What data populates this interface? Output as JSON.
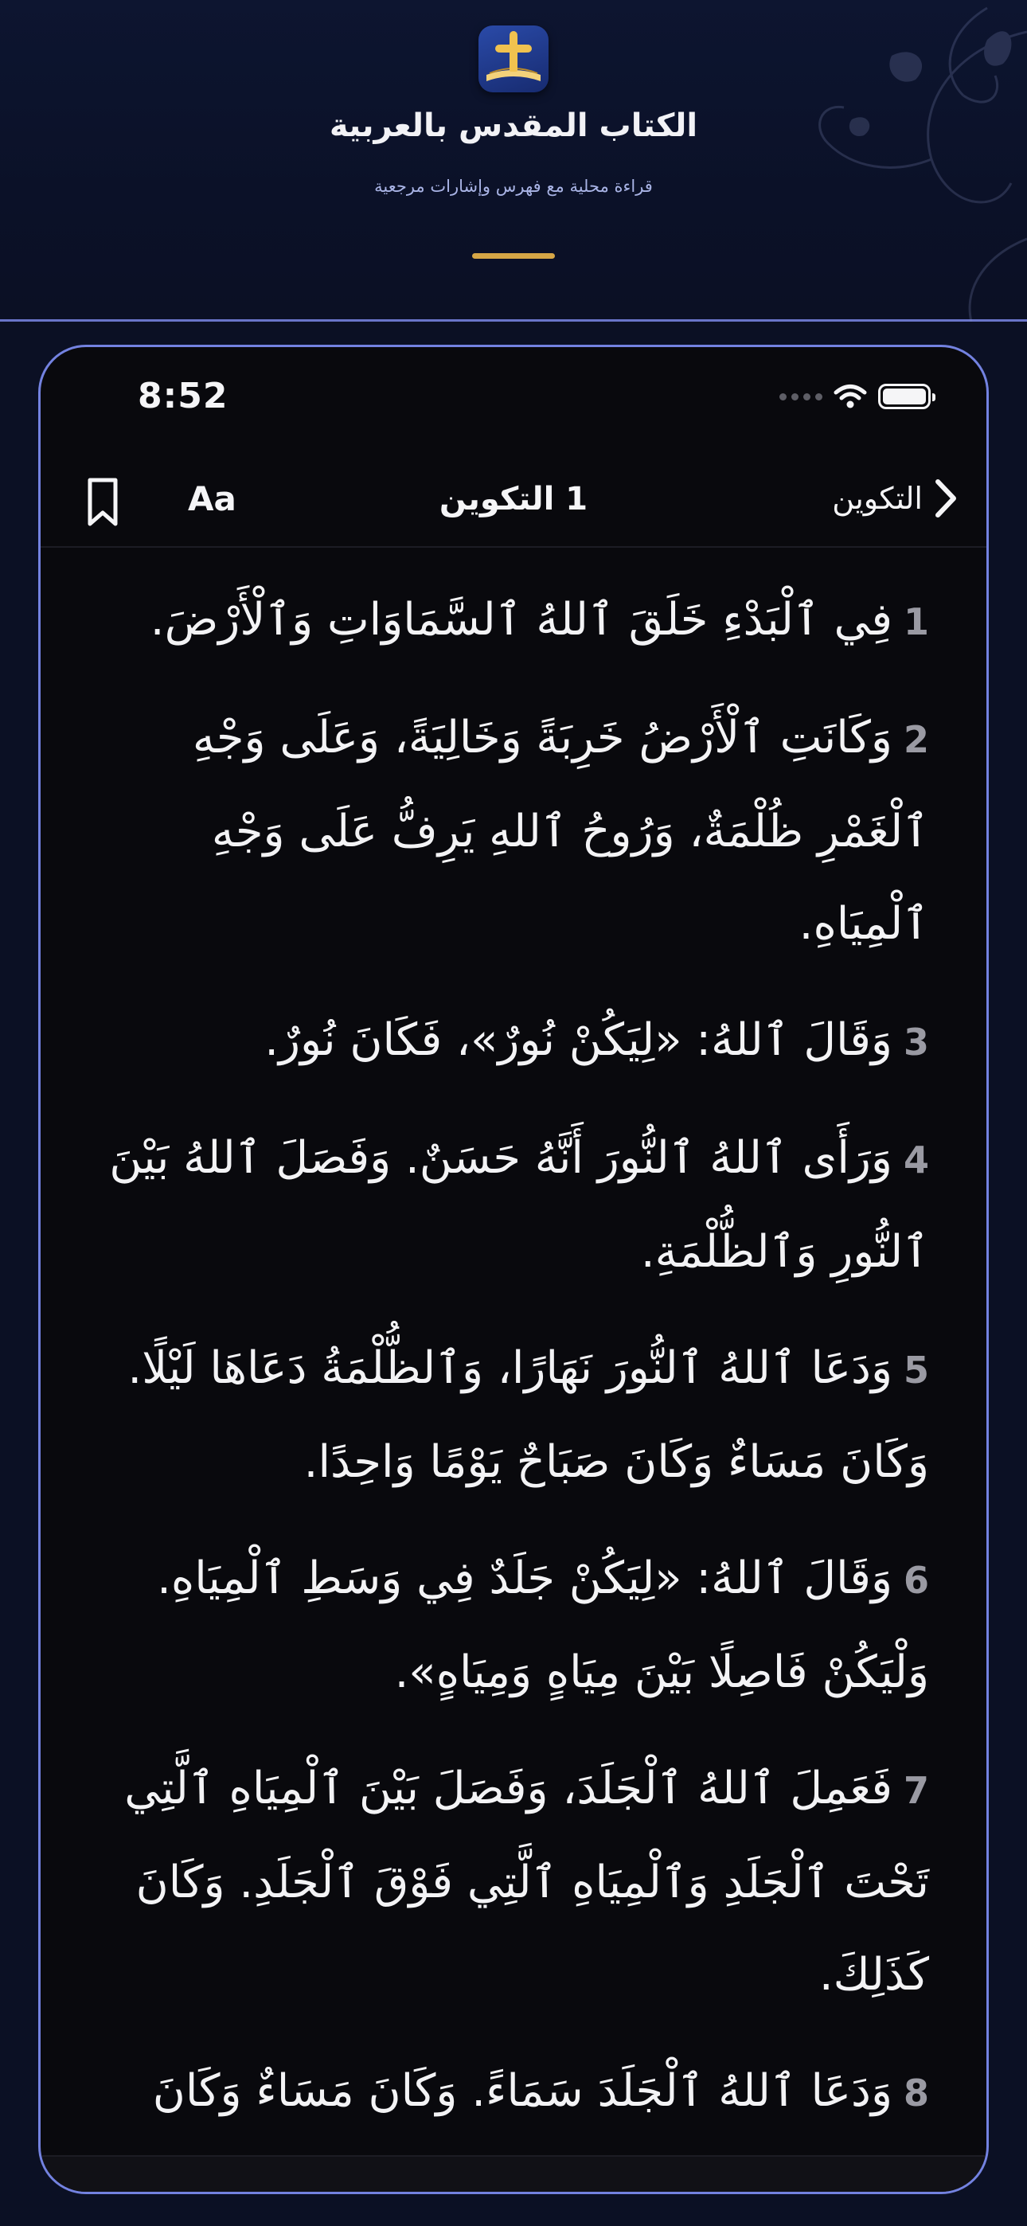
{
  "hero": {
    "title": "الكتاب المقدس بالعربية",
    "subtitle": "قراءة محلية مع فهرس وإشارات مرجعية",
    "app_icon": "bible-cross-icon",
    "accent_color": "#d6a646"
  },
  "status_bar": {
    "time": "8:52",
    "icons": [
      "signal-dots-icon",
      "wifi-icon",
      "battery-icon"
    ]
  },
  "navbar": {
    "back_label": "التكوين",
    "chapter_title": "1 التكوين",
    "font_button_label": "Aa",
    "bookmark_icon": "bookmark-icon"
  },
  "verses": [
    {
      "num": "1",
      "text": "فِي ٱلْبَدْءِ خَلَقَ ٱللهُ ٱلسَّمَاوَاتِ وَٱلْأَرْضَ."
    },
    {
      "num": "2",
      "text": "وَكَانَتِ ٱلْأَرْضُ خَرِبَةً وَخَالِيَةً، وَعَلَى وَجْهِ ٱلْغَمْرِ ظُلْمَةٌ، وَرُوحُ ٱللهِ يَرِفُّ عَلَى وَجْهِ ٱلْمِيَاهِ."
    },
    {
      "num": "3",
      "text": "وَقَالَ ٱللهُ: «لِيَكُنْ نُورٌ»، فَكَانَ نُورٌ."
    },
    {
      "num": "4",
      "text": "وَرَأَى ٱللهُ ٱلنُّورَ أَنَّهُ حَسَنٌ. وَفَصَلَ ٱللهُ بَيْنَ ٱلنُّورِ وَٱلظُّلْمَةِ."
    },
    {
      "num": "5",
      "text": "وَدَعَا ٱللهُ ٱلنُّورَ نَهَارًا، وَٱلظُّلْمَةُ دَعَاهَا لَيْلًا. وَكَانَ مَسَاءٌ وَكَانَ صَبَاحٌ يَوْمًا وَاحِدًا."
    },
    {
      "num": "6",
      "text": "وَقَالَ ٱللهُ: «لِيَكُنْ جَلَدٌ فِي وَسَطِ ٱلْمِيَاهِ. وَلْيَكُنْ فَاصِلًا بَيْنَ مِيَاهٍ وَمِيَاهٍ»."
    },
    {
      "num": "7",
      "text": "فَعَمِلَ ٱللهُ ٱلْجَلَدَ، وَفَصَلَ بَيْنَ ٱلْمِيَاهِ ٱلَّتِي تَحْتَ ٱلْجَلَدِ وَٱلْمِيَاهِ ٱلَّتِي فَوْقَ ٱلْجَلَدِ. وَكَانَ كَذَلِكَ."
    },
    {
      "num": "8",
      "text": "وَدَعَا ٱللهُ ٱلْجَلَدَ سَمَاءً. وَكَانَ مَسَاءٌ وَكَانَ صَبَاحٌ يَوْمًا ثَانِيًا."
    }
  ],
  "colors": {
    "background": "#0b1024",
    "phone_border": "#7382e0",
    "reader_background": "#09090d",
    "verse_number": "#9a9aa3"
  }
}
